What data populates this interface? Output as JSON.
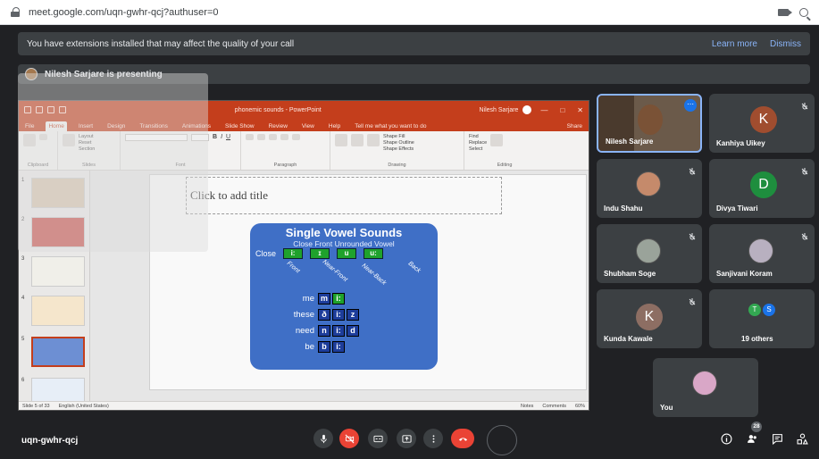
{
  "browser": {
    "url": "meet.google.com/uqn-gwhr-qcj?authuser=0"
  },
  "banner": {
    "message": "You have extensions installed that may affect the quality of your call",
    "learn_more": "Learn more",
    "dismiss": "Dismiss"
  },
  "presenting": {
    "text": "Nilesh Sarjare is presenting"
  },
  "ppt": {
    "doc_title": "phonemic sounds - PowerPoint",
    "user": "Nilesh Sarjare",
    "tabs": [
      "File",
      "Home",
      "Insert",
      "Design",
      "Transitions",
      "Animations",
      "Slide Show",
      "Review",
      "View",
      "Help",
      "Tell me what you want to do"
    ],
    "share": "Share",
    "groups": [
      "Clipboard",
      "Slides",
      "Font",
      "Paragraph",
      "Drawing",
      "Editing"
    ],
    "ribbon_labels": {
      "paste": "Paste",
      "new_slide": "New Slide",
      "layout": "Layout",
      "reset": "Reset",
      "section": "Section",
      "shapes": "Shapes",
      "arrange": "Arrange",
      "quick_styles": "Quick Styles",
      "shape_fill": "Shape Fill",
      "shape_outline": "Shape Outline",
      "shape_effects": "Shape Effects",
      "find": "Find",
      "replace": "Replace",
      "select": "Select",
      "pens": "Pens"
    },
    "thumbnails": [
      "1",
      "2",
      "3",
      "4",
      "5",
      "6"
    ],
    "slide": {
      "title_placeholder": "Click to add title",
      "heading": "Single Vowel Sounds",
      "subheading": "Close Front Unrounded Vowel",
      "close_label": "Close",
      "close_symbols": [
        "i:",
        "ɪ",
        "u",
        "u:"
      ],
      "diagonals": [
        "Front",
        "Near-Front",
        "Near-Back",
        "Back"
      ],
      "words": [
        {
          "word": "me",
          "symbols": [
            "m",
            "i:"
          ]
        },
        {
          "word": "these",
          "symbols": [
            "ð",
            "i:",
            "z"
          ]
        },
        {
          "word": "need",
          "symbols": [
            "n",
            "i:",
            "d"
          ]
        },
        {
          "word": "be",
          "symbols": [
            "b",
            "i:"
          ]
        }
      ]
    },
    "status": {
      "slide_of": "Slide 5 of 33",
      "language": "English (United States)",
      "notes": "Notes",
      "comments": "Comments",
      "zoom": "60%"
    }
  },
  "participants": [
    {
      "name": "Nilesh Sarjare",
      "type": "video"
    },
    {
      "name": "Kanhiya Uikey",
      "letter": "K",
      "color": "#a04d2f"
    },
    {
      "name": "Indu Shahu",
      "type": "photo"
    },
    {
      "name": "Divya Tiwari",
      "letter": "D",
      "color": "#1e8e3e"
    },
    {
      "name": "Shubham Soge",
      "type": "photo"
    },
    {
      "name": "Sanjivani Koram",
      "type": "photo"
    },
    {
      "name": "Kunda Kawale",
      "letter": "K",
      "color": "#8d6e63"
    },
    {
      "name": "19 others",
      "bubbles": [
        "T",
        "S"
      ]
    },
    {
      "name": "You",
      "type": "photo"
    }
  ],
  "bottom": {
    "meeting_code": "uqn-gwhr-qcj",
    "participant_count": "28"
  }
}
